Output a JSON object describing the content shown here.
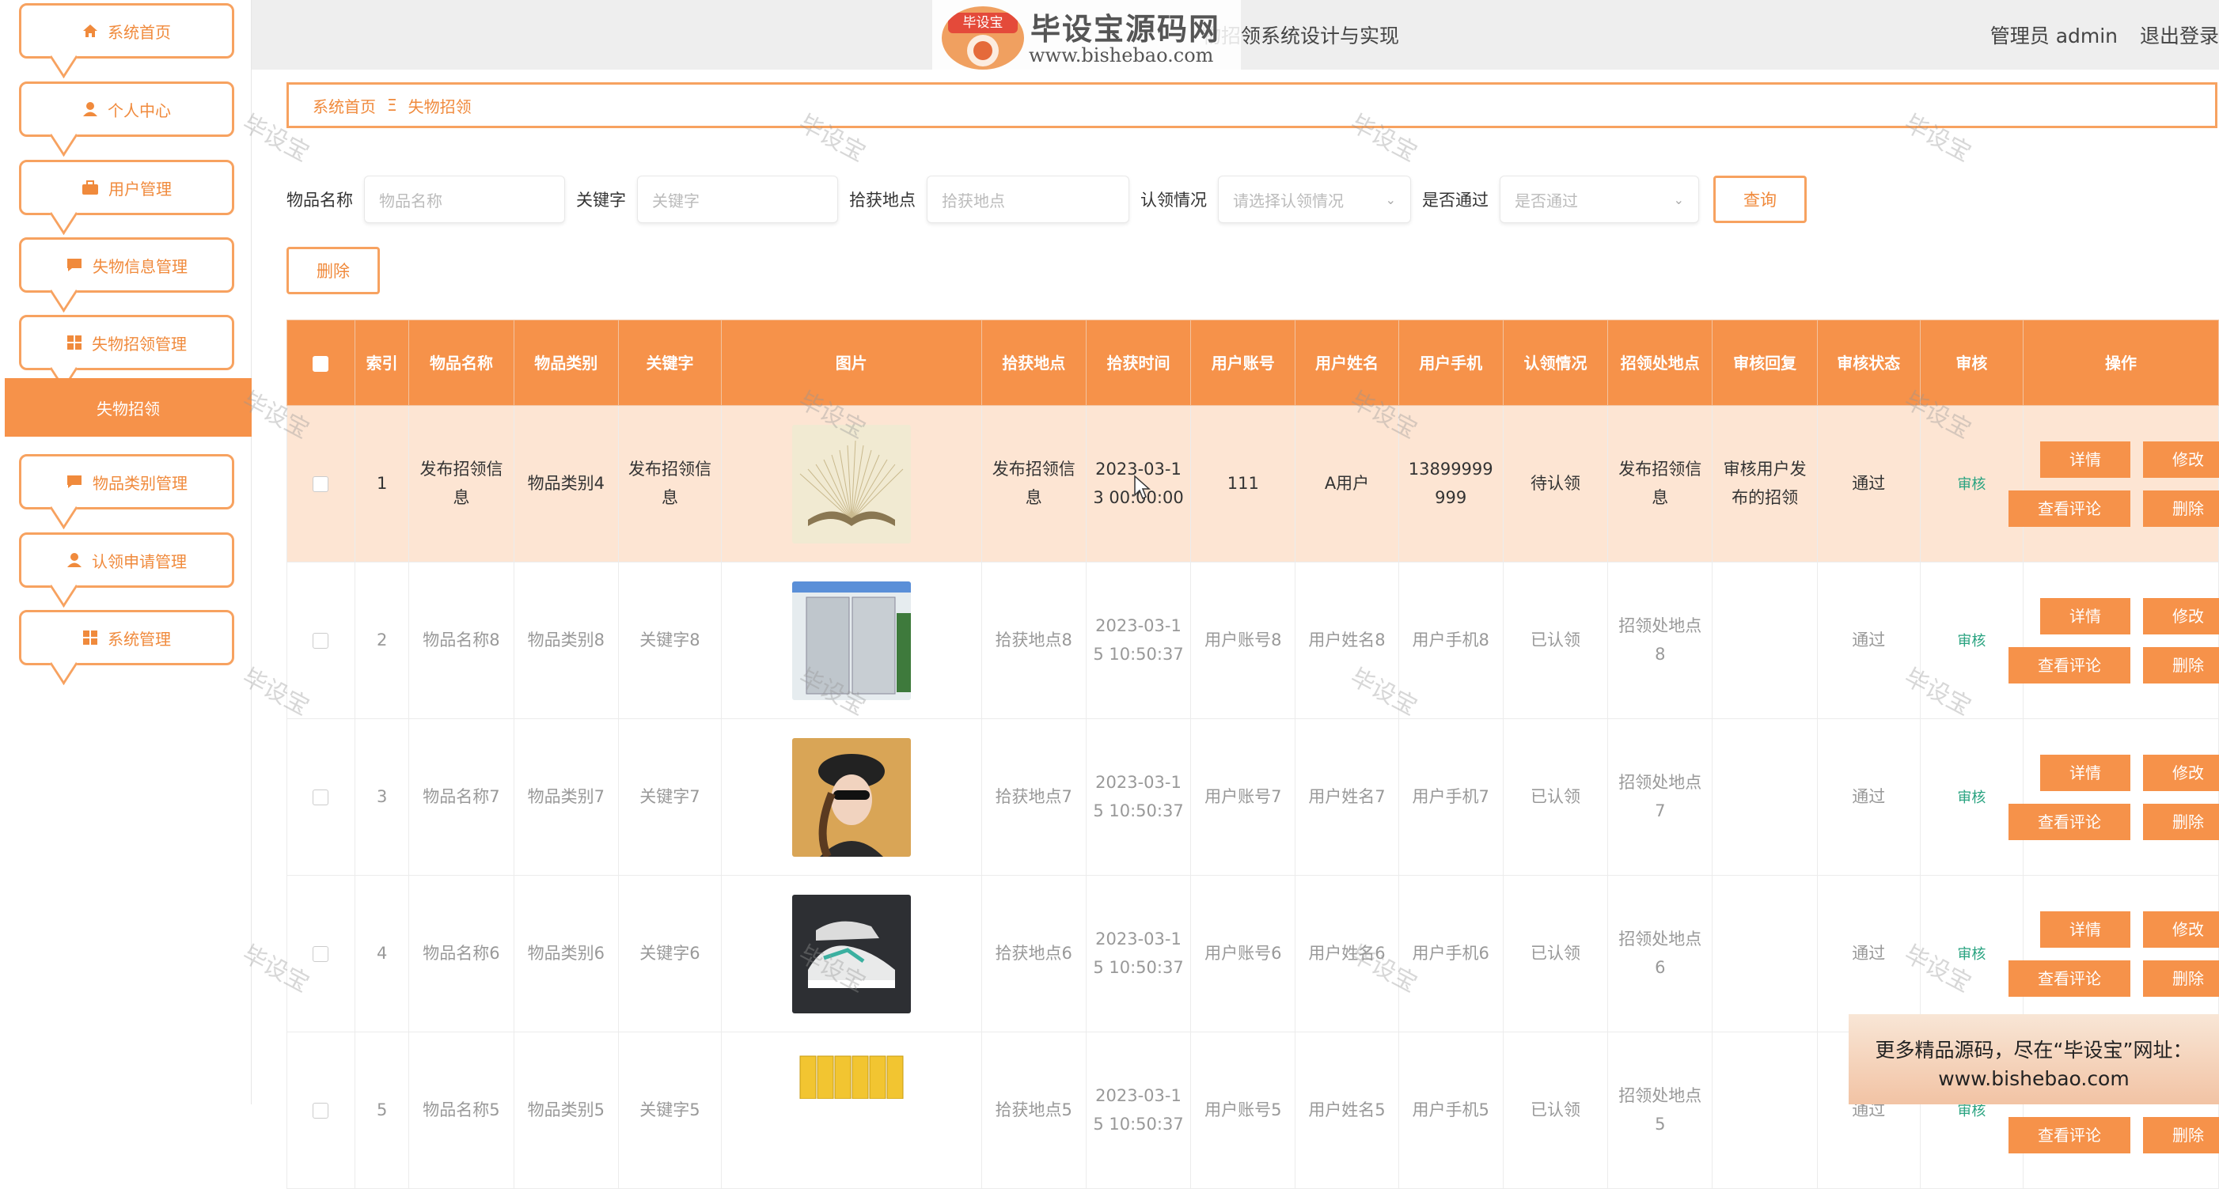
{
  "sidebar": {
    "items": [
      {
        "label": "系统首页",
        "icon": "home-icon"
      },
      {
        "label": "个人中心",
        "icon": "user-icon"
      },
      {
        "label": "用户管理",
        "icon": "briefcase-icon"
      },
      {
        "label": "失物信息管理",
        "icon": "chat-icon"
      },
      {
        "label": "失物招领管理",
        "icon": "grid-icon"
      },
      {
        "label": "物品类别管理",
        "icon": "chat-icon"
      },
      {
        "label": "认领申请管理",
        "icon": "user-icon"
      },
      {
        "label": "系统管理",
        "icon": "grid-icon"
      }
    ],
    "active_sub": "失物招领"
  },
  "header": {
    "title": "物招领系统设计与实现",
    "user": "管理员 admin",
    "logout": "退出登录"
  },
  "logo": {
    "badge": "毕设宝",
    "main": "毕设宝源码网",
    "url": "www.bishebao.com"
  },
  "breadcrumb": {
    "home": "系统首页",
    "sep": "Ξ",
    "current": "失物招领"
  },
  "search": {
    "fields": [
      {
        "label": "物品名称",
        "placeholder": "物品名称"
      },
      {
        "label": "关键字",
        "placeholder": "关键字"
      },
      {
        "label": "拾获地点",
        "placeholder": "拾获地点"
      },
      {
        "label": "认领情况",
        "placeholder": "请选择认领情况"
      },
      {
        "label": "是否通过",
        "placeholder": "是否通过"
      }
    ],
    "query_button": "查询",
    "delete_button": "删除"
  },
  "table": {
    "headers": [
      "",
      "索引",
      "物品名称",
      "物品类别",
      "关键字",
      "图片",
      "拾获地点",
      "拾获时间",
      "用户账号",
      "用户姓名",
      "用户手机",
      "认领情况",
      "招领处地点",
      "审核回复",
      "审核状态",
      "审核",
      "操作"
    ],
    "rows": [
      {
        "index": "1",
        "name": "发布招领信息",
        "category": "物品类别4",
        "keyword": "发布招领信息",
        "image": "book",
        "place": "发布招领信息",
        "time": "2023-03-13 00:00:00",
        "account": "111",
        "username": "A用户",
        "phone": "13899999999",
        "claim": "待认领",
        "office": "发布招领信息",
        "reply": "审核用户发布的招领",
        "status": "通过",
        "audit": "审核"
      },
      {
        "index": "2",
        "name": "物品名称8",
        "category": "物品类别8",
        "keyword": "关键字8",
        "image": "fridge",
        "place": "拾获地点8",
        "time": "2023-03-15 10:50:37",
        "account": "用户账号8",
        "username": "用户姓名8",
        "phone": "用户手机8",
        "claim": "已认领",
        "office": "招领处地点8",
        "reply": "",
        "status": "通过",
        "audit": "审核"
      },
      {
        "index": "3",
        "name": "物品名称7",
        "category": "物品类别7",
        "keyword": "关键字7",
        "image": "woman",
        "place": "拾获地点7",
        "time": "2023-03-15 10:50:37",
        "account": "用户账号7",
        "username": "用户姓名7",
        "phone": "用户手机7",
        "claim": "已认领",
        "office": "招领处地点7",
        "reply": "",
        "status": "通过",
        "audit": "审核"
      },
      {
        "index": "4",
        "name": "物品名称6",
        "category": "物品类别6",
        "keyword": "关键字6",
        "image": "shoe",
        "place": "拾获地点6",
        "time": "2023-03-15 10:50:37",
        "account": "用户账号6",
        "username": "用户姓名6",
        "phone": "用户手机6",
        "claim": "已认领",
        "office": "招领处地点6",
        "reply": "",
        "status": "通过",
        "audit": "审核"
      },
      {
        "index": "5",
        "name": "物品名称5",
        "category": "物品类别5",
        "keyword": "关键字5",
        "image": "books",
        "place": "拾获地点5",
        "time": "2023-03-15 10:50:37",
        "account": "用户账号5",
        "username": "用户姓名5",
        "phone": "用户手机5",
        "claim": "已认领",
        "office": "招领处地点5",
        "reply": "",
        "status": "通过",
        "audit": "审核"
      }
    ],
    "op_labels": {
      "detail": "详情",
      "edit": "修改",
      "comments": "查看评论",
      "delete": "删除"
    }
  },
  "watermark": "毕设宝",
  "ad": {
    "line1": "更多精品源码，尽在“毕设宝”网址：",
    "line2": "www.bishebao.com"
  },
  "colors": {
    "accent": "#f6924a",
    "accent_border": "#f7a260",
    "highlight_row": "#fde5d3",
    "audit_link": "#29a380"
  }
}
